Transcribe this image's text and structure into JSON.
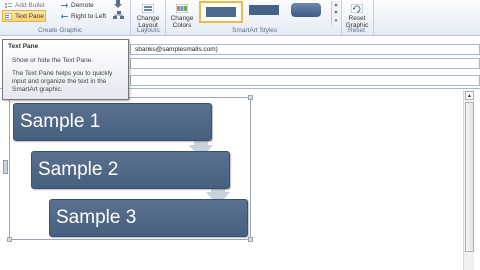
{
  "ribbon": {
    "create_graphic": {
      "add_bullet": "Add Bullet",
      "text_pane": "Text Pane",
      "demote": "Demote",
      "right_to_left": "Right to Left",
      "label": "Create Graphic"
    },
    "layouts": {
      "change_layout": "Change Layout",
      "label": "Layouts"
    },
    "smartart_styles": {
      "change_colors": "Change Colors",
      "label": "SmartArt Styles"
    },
    "reset": {
      "reset_graphic": "Reset Graphic",
      "label": "Reset"
    }
  },
  "tooltip": {
    "title": "Text Pane",
    "line1": "Show or hide the Text Pane.",
    "line2": "The Text Pane helps you to quickly input and organize the text in the SmartArt graphic."
  },
  "email": {
    "to_value": "sbanks@samplesmalls.com)"
  },
  "smartart": {
    "items": [
      "Sample 1",
      "Sample 2",
      "Sample 3"
    ],
    "box_color": "#4f6a8f",
    "arrow_color": "#c9d1dc"
  },
  "colors": {
    "ribbon_bg": "#e4ebf5",
    "highlight": "#ffd36a"
  }
}
